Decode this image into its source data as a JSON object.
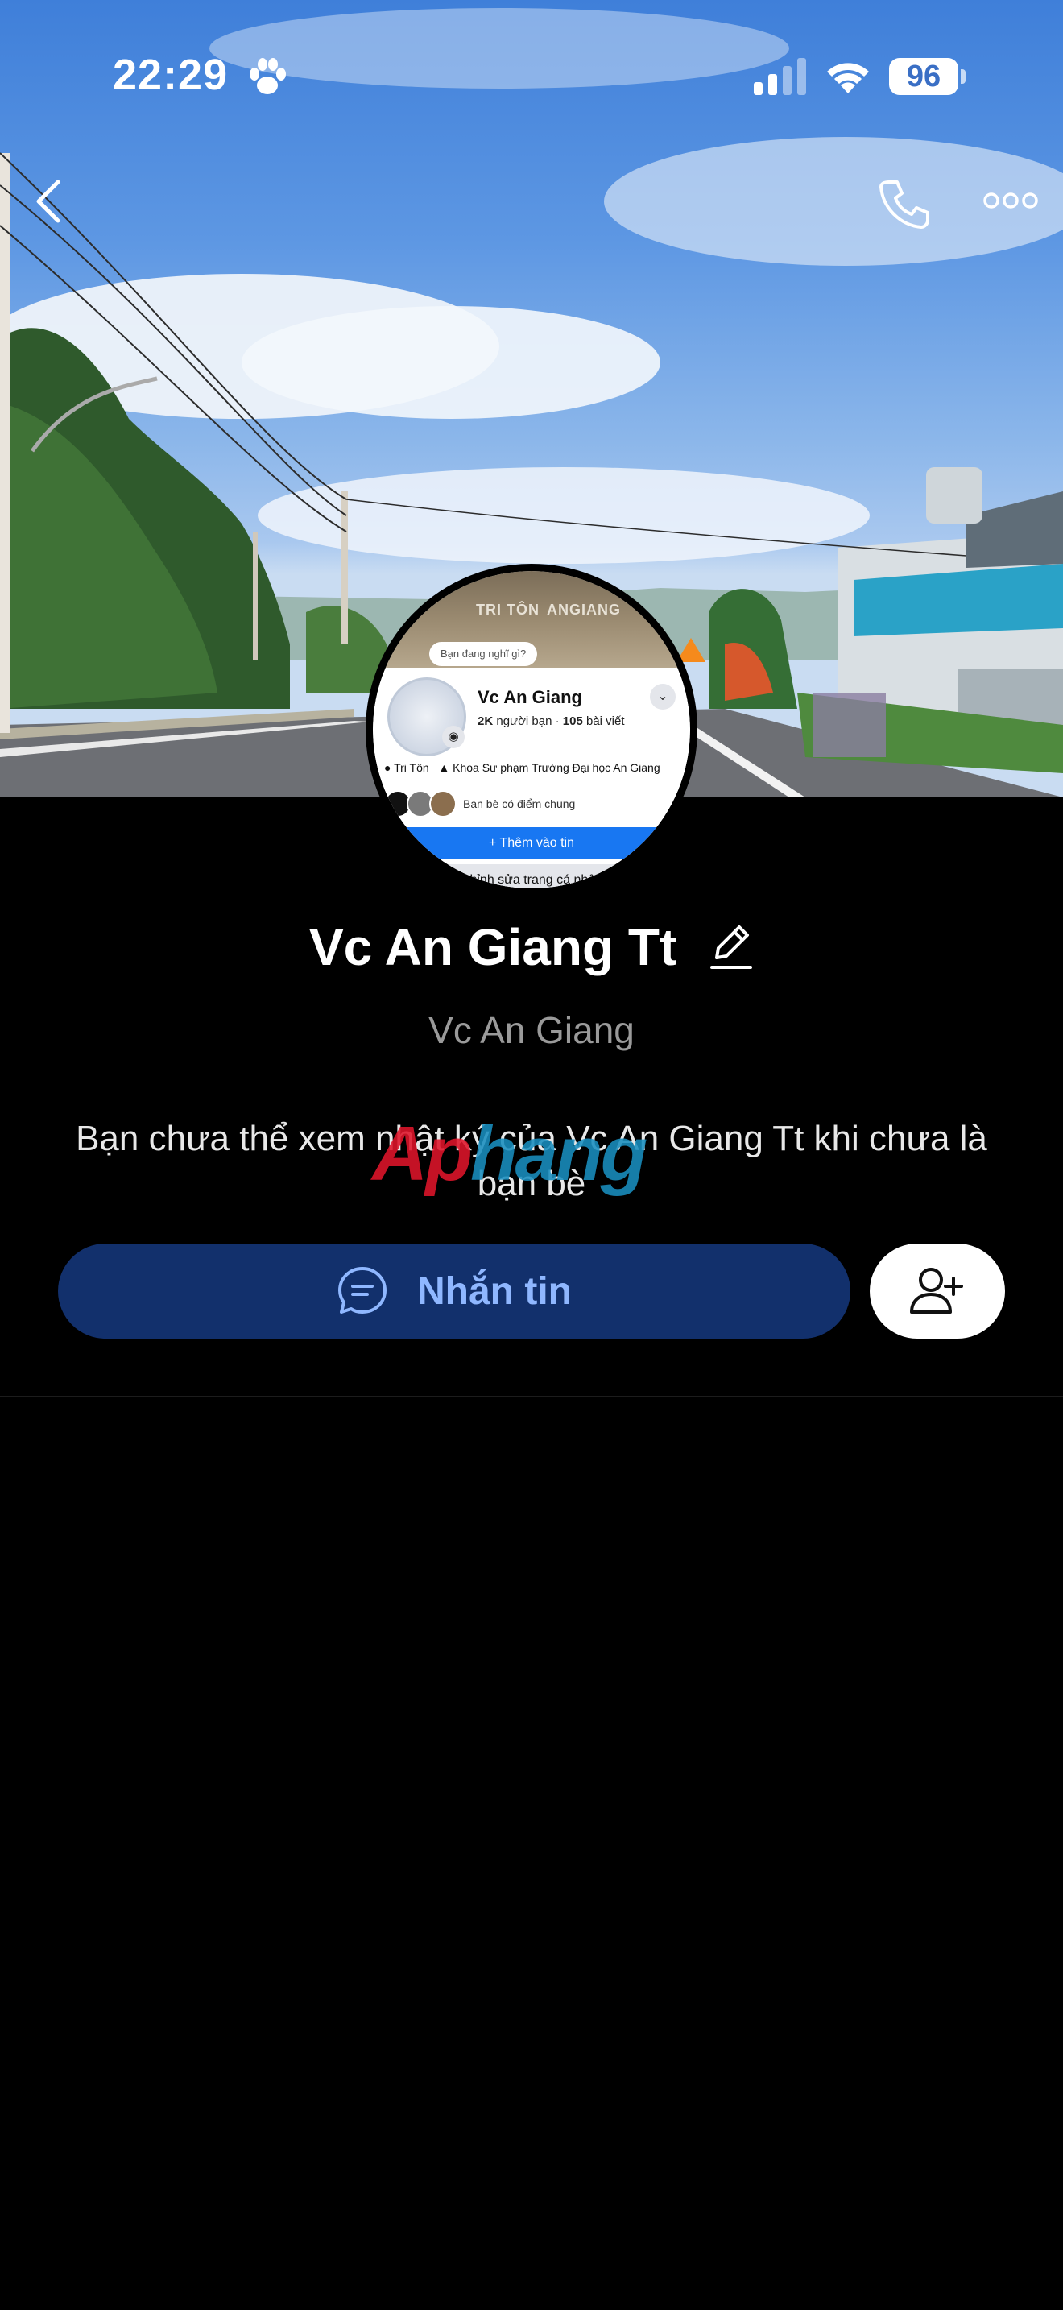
{
  "status_bar": {
    "time": "22:29",
    "battery": "96",
    "icons": [
      "paw-icon",
      "signal-icon",
      "wifi-icon",
      "battery-icon"
    ]
  },
  "nav": {
    "icons": [
      "back-icon",
      "phone-icon",
      "more-icon"
    ]
  },
  "cover": {
    "sign_texts": [
      "TRI TÔN",
      "ANGIANG"
    ]
  },
  "avatar_screenshot": {
    "prompt": "Bạn đang nghĩ gì?",
    "name": "Vc An Giang",
    "friends_count": "2K",
    "friends_label": "người bạn",
    "posts_count": "105",
    "posts_label": "bài viết",
    "location": "Tri Tôn",
    "school": "Khoa Sư phạm Trường Đại học An Giang",
    "mutual": "Bạn bè có điểm chung",
    "add_story": "+ Thêm vào tin",
    "edit_profile": "Chỉnh sửa trang cá nhân"
  },
  "profile": {
    "display_name": "Vc An Giang Tt",
    "original_name": "Vc An Giang",
    "notice": "Bạn chưa thể xem nhật ký của Vc An Giang Tt khi chưa là bạn bè"
  },
  "watermark": {
    "part1": "Ap",
    "part2": "hang"
  },
  "actions": {
    "message_label": "Nhắn tin",
    "add_friend_icon": "add-friend-icon"
  },
  "colors": {
    "message_button_bg": "#12306c",
    "message_button_text": "#8fb7ff",
    "background": "#000000",
    "subtitle": "#9a9a9a"
  }
}
